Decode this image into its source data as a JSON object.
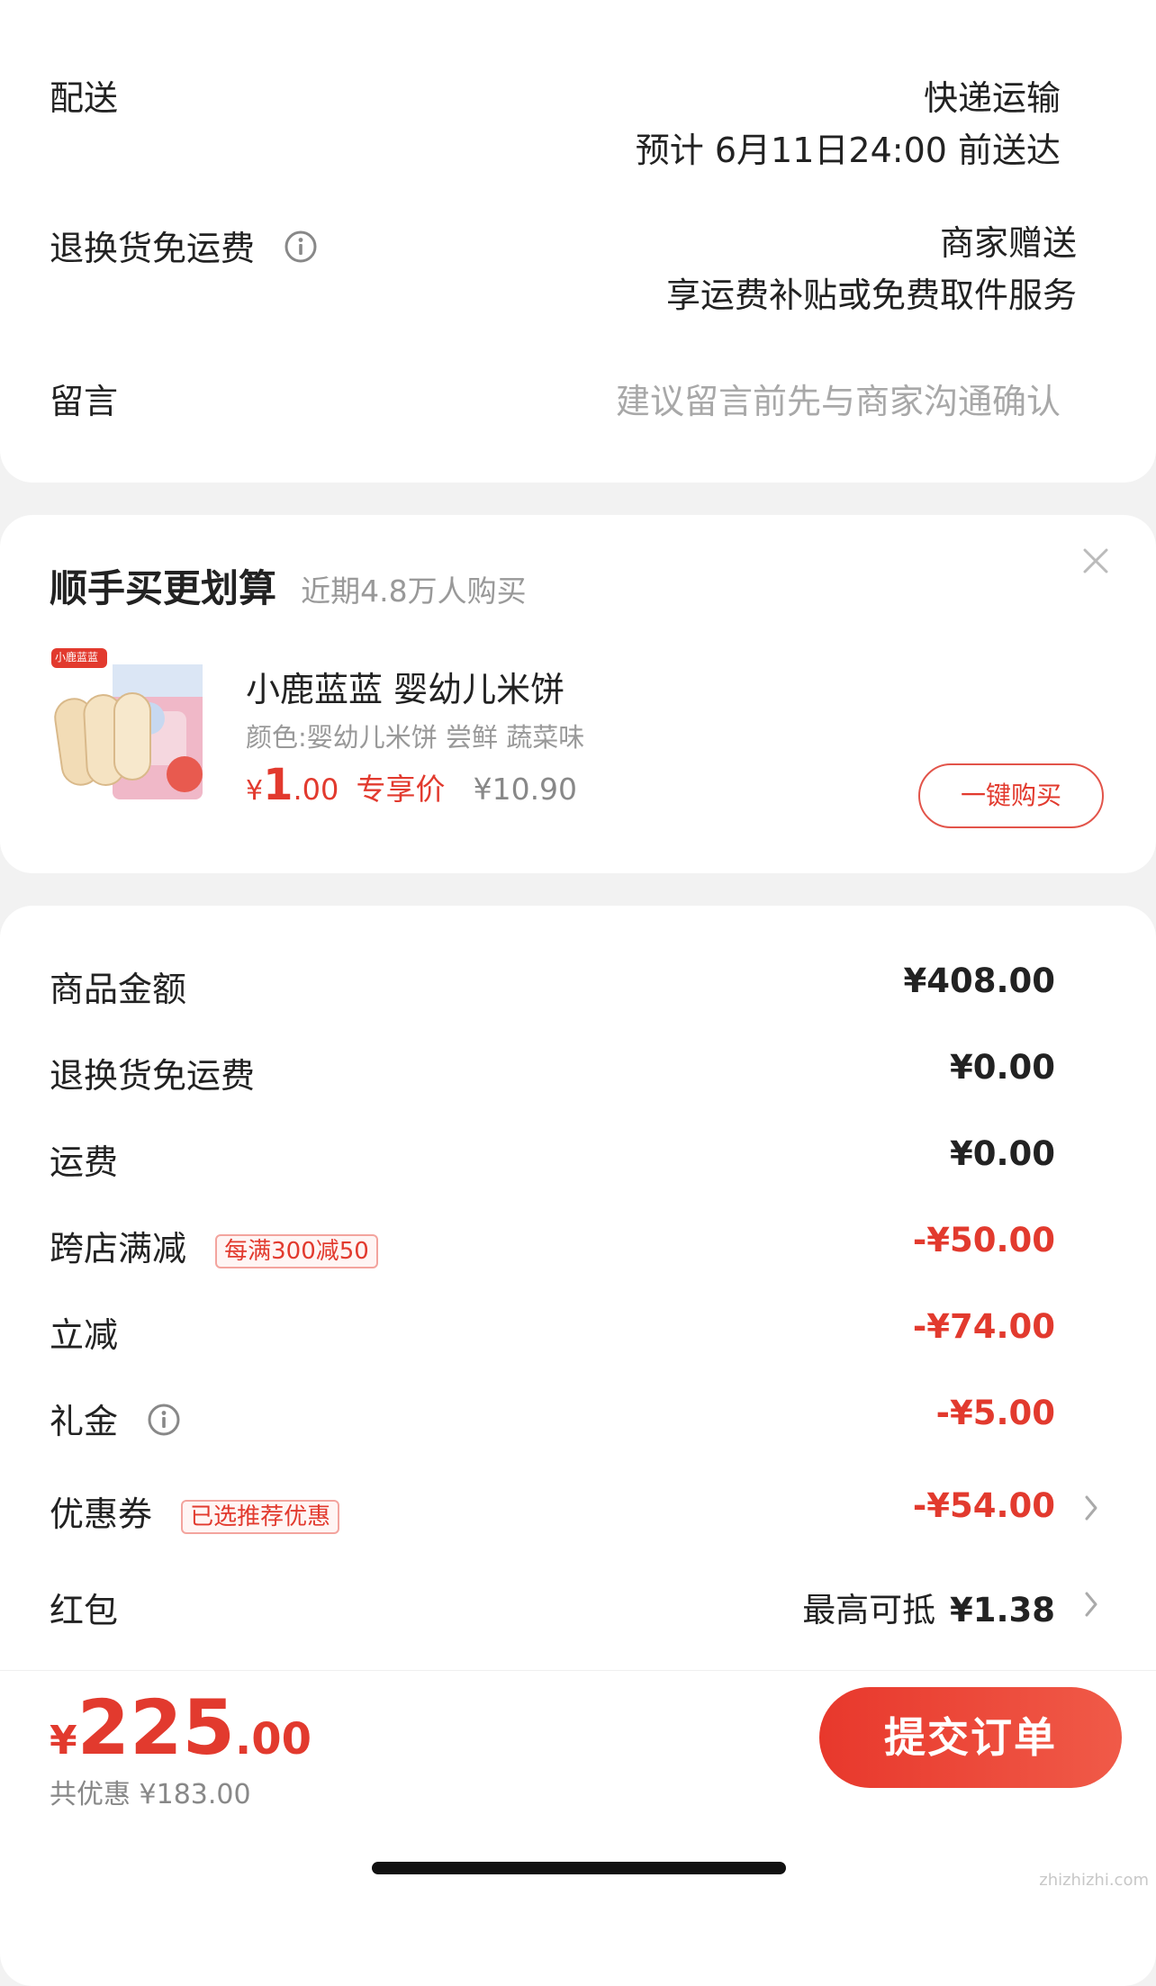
{
  "delivery": {
    "label": "配送",
    "method": "快递运输",
    "eta": "预计 6月11日24:00 前送达"
  },
  "return_freight": {
    "label": "退换货免运费",
    "value_line1": "商家赠送",
    "value_line2": "享运费补贴或免费取件服务"
  },
  "message": {
    "label": "留言",
    "placeholder": "建议留言前先与商家沟通确认"
  },
  "upsell": {
    "title": "顺手买更划算",
    "subtitle": "近期4.8万人购买",
    "product": {
      "name": "小鹿蓝蓝 婴幼儿米饼",
      "spec": "颜色:婴幼儿米饼 尝鲜 蔬菜味",
      "price_symbol": "¥",
      "price_int": "1",
      "price_dec": ".00",
      "price_tag": "专享价",
      "original_price": "¥10.90",
      "image_brand": "小鹿蓝蓝",
      "buy_button": "一键购买"
    }
  },
  "summary": {
    "rows": [
      {
        "label": "商品金额",
        "value": "¥408.00",
        "color": "#222222"
      },
      {
        "label": "退换货免运费",
        "value": "¥0.00",
        "color": "#222222"
      },
      {
        "label": "运费",
        "value": "¥0.00",
        "color": "#222222"
      },
      {
        "label": "跨店满减",
        "tag": "每满300减50",
        "value": "-¥50.00",
        "color": "#e23a2e"
      },
      {
        "label": "立减",
        "value": "-¥74.00",
        "color": "#e23a2e"
      },
      {
        "label": "礼金",
        "value": "-¥5.00",
        "color": "#e23a2e"
      },
      {
        "label": "优惠券",
        "tag": "已选推荐优惠",
        "value": "-¥54.00",
        "color": "#e23a2e"
      },
      {
        "label": "红包",
        "value_prefix": "最高可抵",
        "value": "¥1.38",
        "color": "#222222"
      }
    ]
  },
  "footer": {
    "total_symbol": "¥",
    "total_int": "225",
    "total_dec": ".00",
    "discount_text": "共优惠 ¥183.00",
    "submit_button": "提交订单"
  },
  "watermark": {
    "text": "zhizhizhi.com"
  },
  "colors": {
    "accent": "#e23a2e",
    "background": "#f2f2f2"
  }
}
